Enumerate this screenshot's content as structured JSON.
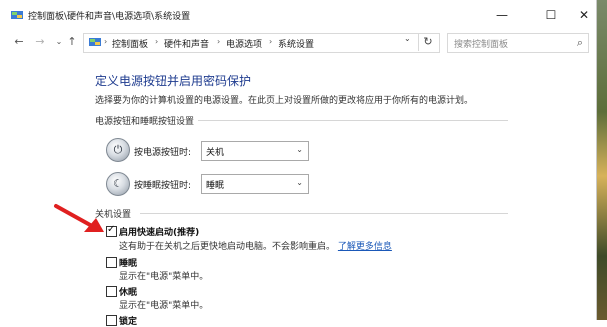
{
  "window": {
    "title": "控制面板\\硬件和声音\\电源选项\\系统设置",
    "minimize_glyph": "—",
    "maximize_glyph": "☐",
    "close_glyph": "✕"
  },
  "nav": {
    "back_icon": "arrow-left-icon",
    "forward_icon": "arrow-right-icon",
    "recent_icon": "chevron-down-icon",
    "up_icon": "arrow-up-icon",
    "breadcrumb": [
      "控制面板",
      "硬件和声音",
      "电源选项",
      "系统设置"
    ],
    "search_placeholder": "搜索控制面板"
  },
  "page": {
    "title": "定义电源按钮并启用密码保护",
    "description": "选择要为你的计算机设置的电源设置。在此页上对设置所做的更改将应用于你所有的电源计划。"
  },
  "power_buttons_group": {
    "title": "电源按钮和睡眠按钮设置",
    "rows": [
      {
        "label": "按电源按钮时:",
        "value": "关机",
        "icon": "power-button-icon"
      },
      {
        "label": "按睡眠按钮时:",
        "value": "睡眠",
        "icon": "sleep-button-icon"
      }
    ]
  },
  "shutdown_group": {
    "title": "关机设置",
    "options": [
      {
        "label": "启用快速启动(推荐)",
        "checked": true,
        "desc": "这有助于在关机之后更快地启动电脑。不会影响重启。",
        "link": "了解更多信息"
      },
      {
        "label": "睡眠",
        "checked": false,
        "desc": "显示在\"电源\"菜单中。"
      },
      {
        "label": "休眠",
        "checked": false,
        "desc": "显示在\"电源\"菜单中。"
      },
      {
        "label": "锁定",
        "checked": false,
        "desc": ""
      }
    ]
  },
  "colors": {
    "title_blue": "#1e3b8f",
    "link_blue": "#1a58b8",
    "annotation_red": "#e02020"
  }
}
